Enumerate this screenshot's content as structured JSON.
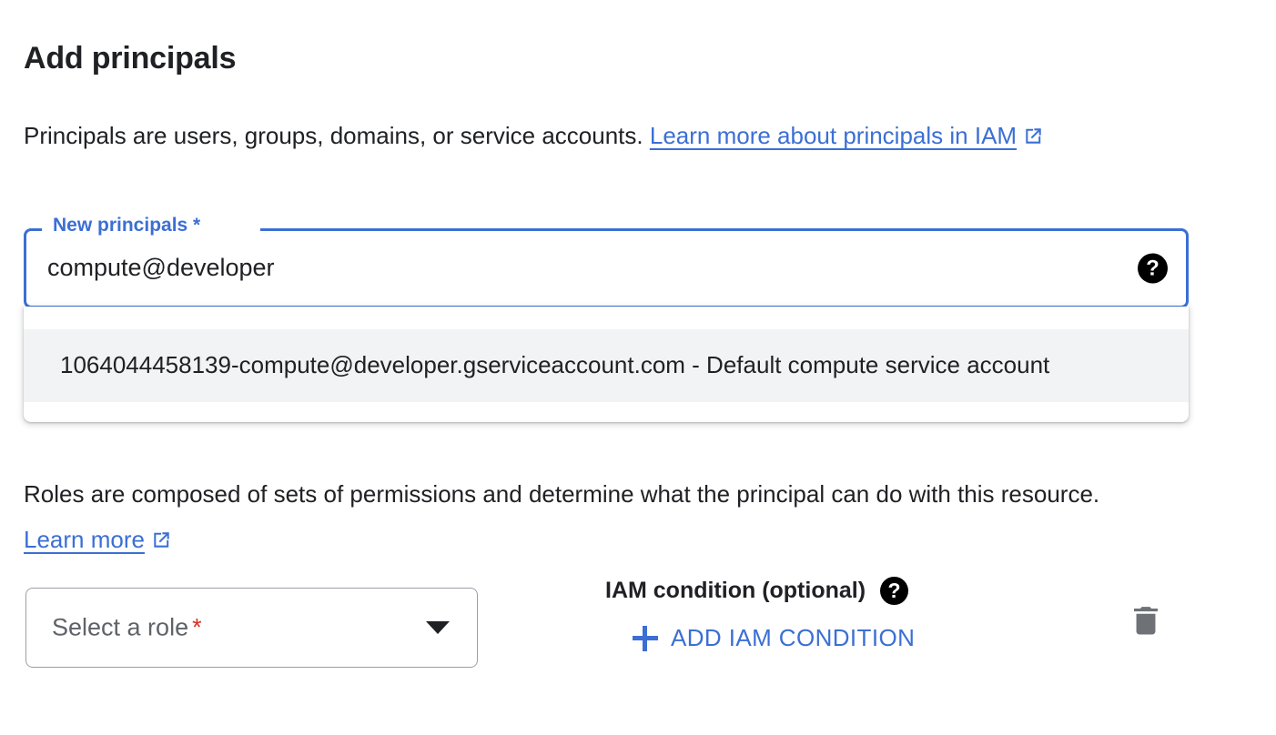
{
  "page": {
    "title": "Add principals"
  },
  "intro": {
    "text_before": "Principals are users, groups, domains, or service accounts. ",
    "link_text": "Learn more about principals in IAM",
    "link_icon": "open-in-new-icon"
  },
  "principals_field": {
    "label": "New principals *",
    "value": "compute@developer",
    "placeholder": "New principals",
    "help_icon": "help-filled-icon",
    "border_color": "#3b6fd4",
    "label_color": "#3b6fd4"
  },
  "suggestions": {
    "items": [
      {
        "text": "1064044458139-compute@developer.gserviceaccount.com - Default compute service account",
        "highlighted": true,
        "background": "#f1f3f4"
      }
    ]
  },
  "roles_description": {
    "text_before": "Roles are composed of sets of permissions and determine what the principal can do with this resource. ",
    "link_text": "Learn more",
    "link_icon": "open-in-new-icon"
  },
  "role_select": {
    "placeholder": "Select a role",
    "required_marker": "*",
    "caret_icon": "chevron-down-icon",
    "text_color": "#5f6368",
    "required_color": "#d93025"
  },
  "iam_condition": {
    "heading": "IAM condition (optional)",
    "help_icon": "help-filled-icon",
    "add_button_label": "ADD IAM CONDITION",
    "add_button_icon": "plus-icon",
    "accent_color": "#3b6fd4"
  },
  "row_actions": {
    "delete_icon": "trash-icon",
    "delete_color": "#6e7175"
  }
}
